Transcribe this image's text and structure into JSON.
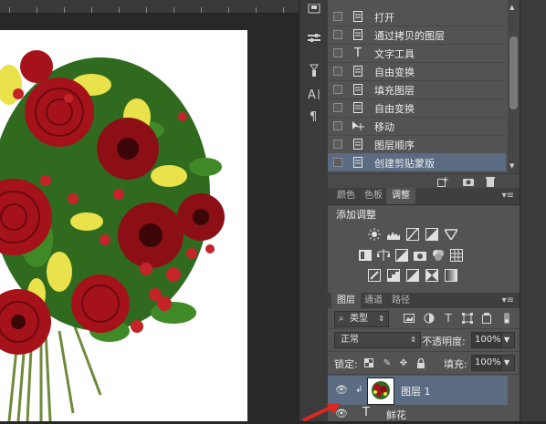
{
  "history": {
    "items": [
      {
        "icon": "doc",
        "label": "打开",
        "selected": false
      },
      {
        "icon": "doc",
        "label": "通过拷贝的图层",
        "selected": false
      },
      {
        "icon": "type",
        "label": "文字工具",
        "selected": false
      },
      {
        "icon": "doc",
        "label": "自由变换",
        "selected": false
      },
      {
        "icon": "doc",
        "label": "填充图层",
        "selected": false
      },
      {
        "icon": "doc",
        "label": "自由变换",
        "selected": false
      },
      {
        "icon": "move",
        "label": "移动",
        "selected": false
      },
      {
        "icon": "doc",
        "label": "图层顺序",
        "selected": false
      },
      {
        "icon": "doc",
        "label": "创建剪贴蒙版",
        "selected": true
      }
    ]
  },
  "adjust": {
    "tabs": [
      "颜色",
      "色板",
      "调整"
    ],
    "active_tab": "调整",
    "title": "添加调整"
  },
  "layers": {
    "tabs": [
      "图层",
      "通道",
      "路径"
    ],
    "active_tab": "图层",
    "filter_kind": "类型",
    "blend_mode": "正常",
    "opacity_label": "不透明度:",
    "opacity_value": "100%",
    "lock_label": "锁定:",
    "fill_label": "填充:",
    "fill_value": "100%",
    "layer_name": "图层 1",
    "next_layer_label": "鲜花"
  },
  "colors": {
    "selection": "#5a6b82",
    "panel": "#535353",
    "arrow": "#e0271f"
  }
}
